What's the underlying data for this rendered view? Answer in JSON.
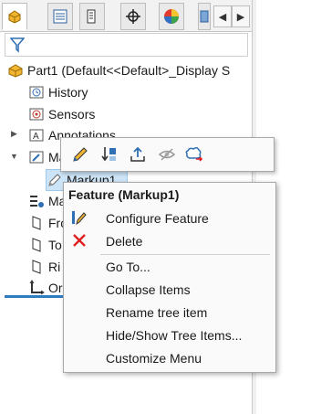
{
  "tabs": [
    {
      "icon": "feature-manager-icon",
      "active": true
    },
    {
      "icon": "property-manager-icon"
    },
    {
      "icon": "configuration-manager-icon"
    },
    {
      "icon": "dimxpert-icon"
    },
    {
      "icon": "display-manager-icon"
    },
    {
      "icon": "cam-icon"
    }
  ],
  "filter": {
    "icon": "filter-icon"
  },
  "tree": {
    "root": "Part1  (Default<<Default>_Display S",
    "items": [
      {
        "label": "History",
        "icon": "history-icon"
      },
      {
        "label": "Sensors",
        "icon": "sensors-icon"
      },
      {
        "label": "Annotations",
        "icon": "annotations-icon"
      },
      {
        "label": "Ma",
        "icon": "markups-icon"
      },
      {
        "label": "Markup1",
        "icon": "markup-icon"
      },
      {
        "label": "Ma",
        "icon": "material-icon"
      },
      {
        "label": "Fro",
        "icon": "plane-icon"
      },
      {
        "label": "To",
        "icon": "plane-icon"
      },
      {
        "label": "Ri",
        "icon": "plane-icon"
      },
      {
        "label": "Or",
        "icon": "origin-icon"
      }
    ]
  },
  "context_menu": {
    "title": "Feature (Markup1)",
    "items": [
      {
        "label": "Configure Feature",
        "icon": "configure-feature-icon"
      },
      {
        "label": "Delete",
        "icon": "delete-icon"
      },
      {
        "label": "Go To..."
      },
      {
        "label": "Collapse Items"
      },
      {
        "label": "Rename tree item"
      },
      {
        "label": "Hide/Show Tree Items..."
      },
      {
        "label": "Customize Menu"
      }
    ]
  },
  "colors": {
    "accent": "#2e7dc0",
    "delete_red": "#e02020",
    "selection": "#cce4f7"
  }
}
